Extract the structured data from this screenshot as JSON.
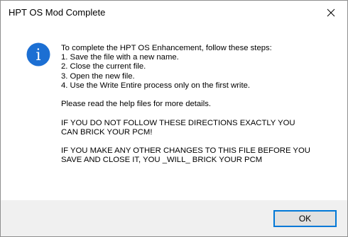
{
  "window": {
    "title": "HPT OS Mod Complete",
    "close_icon": "close-icon"
  },
  "icon": {
    "name": "information-icon",
    "glyph": "i",
    "color": "#1c6fd3"
  },
  "message": {
    "lines": [
      "To complete the HPT OS Enhancement, follow these steps:",
      "1. Save the file with a new name.",
      "2. Close the current file.",
      "3. Open the new file.",
      "4. Use the Write Entire process only on the first write.",
      "",
      "Please read the help files for more details.",
      "",
      "IF YOU DO NOT FOLLOW THESE DIRECTIONS EXACTLY YOU",
      "CAN BRICK YOUR PCM!",
      "",
      "IF YOU MAKE ANY OTHER CHANGES TO THIS FILE BEFORE YOU",
      "SAVE AND CLOSE IT, YOU _WILL_ BRICK YOUR PCM"
    ]
  },
  "buttons": {
    "ok_label": "OK"
  },
  "colors": {
    "footer_bg": "#f0f0f0",
    "button_border": "#0078d7",
    "button_bg": "#e1e1e1"
  }
}
